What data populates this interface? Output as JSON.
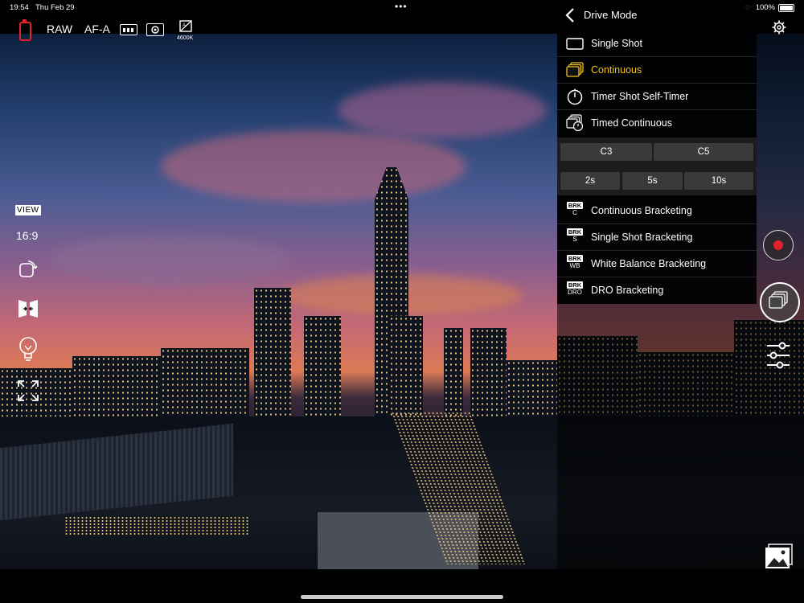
{
  "status_bar": {
    "time": "19:54",
    "date": "Thu Feb 29",
    "battery": "100%"
  },
  "toolbar": {
    "raw": "RAW",
    "af_mode": "AF-A",
    "wb_value": "4600K"
  },
  "left_rail": {
    "view_label": "VIEW",
    "aspect_ratio": "16:9"
  },
  "drive_mode": {
    "title": "Drive Mode",
    "selected_index": 1,
    "modes": [
      {
        "label": "Single Shot",
        "icon": "single-shot-icon"
      },
      {
        "label": "Continuous",
        "icon": "continuous-icon"
      },
      {
        "label": "Timer Shot Self-Timer",
        "icon": "timer-icon"
      },
      {
        "label": "Timed Continuous",
        "icon": "timed-continuous-icon"
      }
    ],
    "continuous_options": [
      "C3",
      "C5"
    ],
    "timer_options": [
      "2s",
      "5s",
      "10s"
    ],
    "bracketing": [
      {
        "label": "Continuous Bracketing",
        "badge": "BRK",
        "sub": "C"
      },
      {
        "label": "Single Shot Bracketing",
        "badge": "BRK",
        "sub": "S"
      },
      {
        "label": "White Balance Bracketing",
        "badge": "BRK",
        "sub": "WB"
      },
      {
        "label": "DRO Bracketing",
        "badge": "BRK",
        "sub": "DRO"
      }
    ]
  },
  "colors": {
    "accent": "#f2c21a",
    "battery": "#e0232b",
    "record": "#e0232b"
  }
}
